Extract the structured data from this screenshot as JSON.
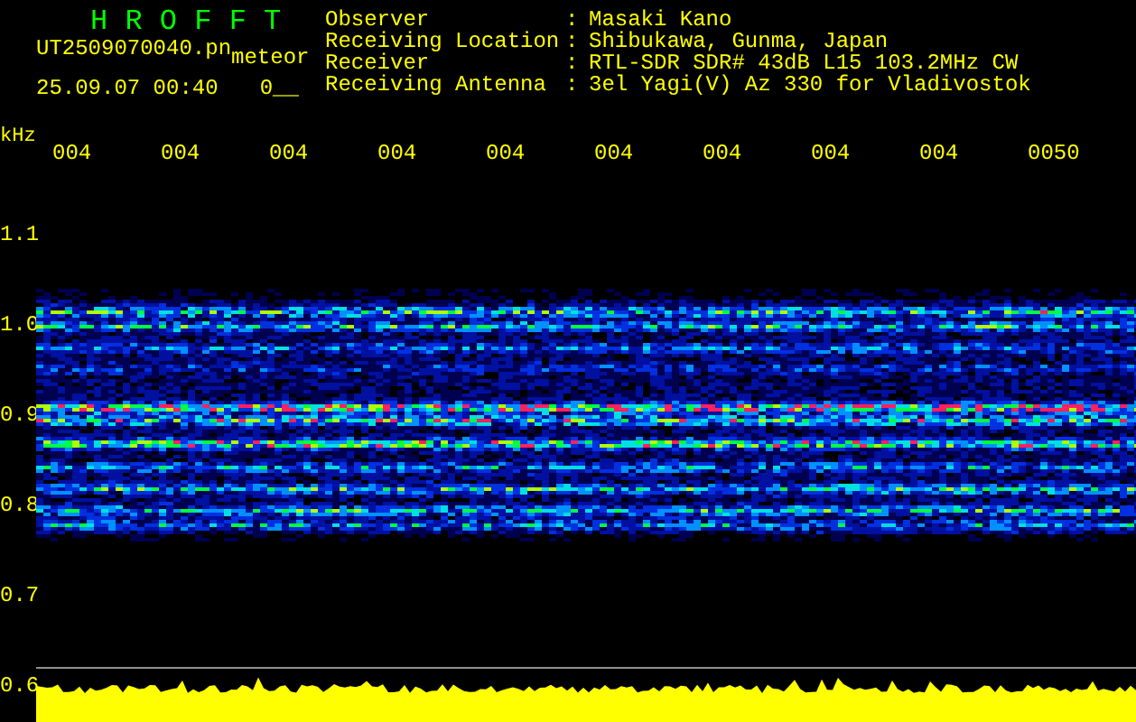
{
  "header": {
    "title": "H R O F F T",
    "file_name": "UT2509070040.pn",
    "file_tag": "meteor",
    "timestamp": "25.09.07 00:40",
    "counter": "0__"
  },
  "station_info": [
    {
      "label": "Observer",
      "separator": ":",
      "value": "Masaki Kano"
    },
    {
      "label": "Receiving Location",
      "separator": ":",
      "value": "Shibukawa, Gunma, Japan"
    },
    {
      "label": "Receiver",
      "separator": ":",
      "value": "RTL-SDR SDR# 43dB L15 103.2MHz CW"
    },
    {
      "label": "Receiving Antenna",
      "separator": ":",
      "value": "3el Yagi(V) Az 330 for Vladivostok"
    }
  ],
  "frequency_unit": "kHz",
  "time_labels": [
    "004",
    "004",
    "004",
    "004",
    "004",
    "004",
    "004",
    "004",
    "004",
    "0050"
  ],
  "frequency_labels": [
    "1.1",
    "1.0",
    "0.9",
    "0.8",
    "0.7",
    "0.6"
  ]
}
